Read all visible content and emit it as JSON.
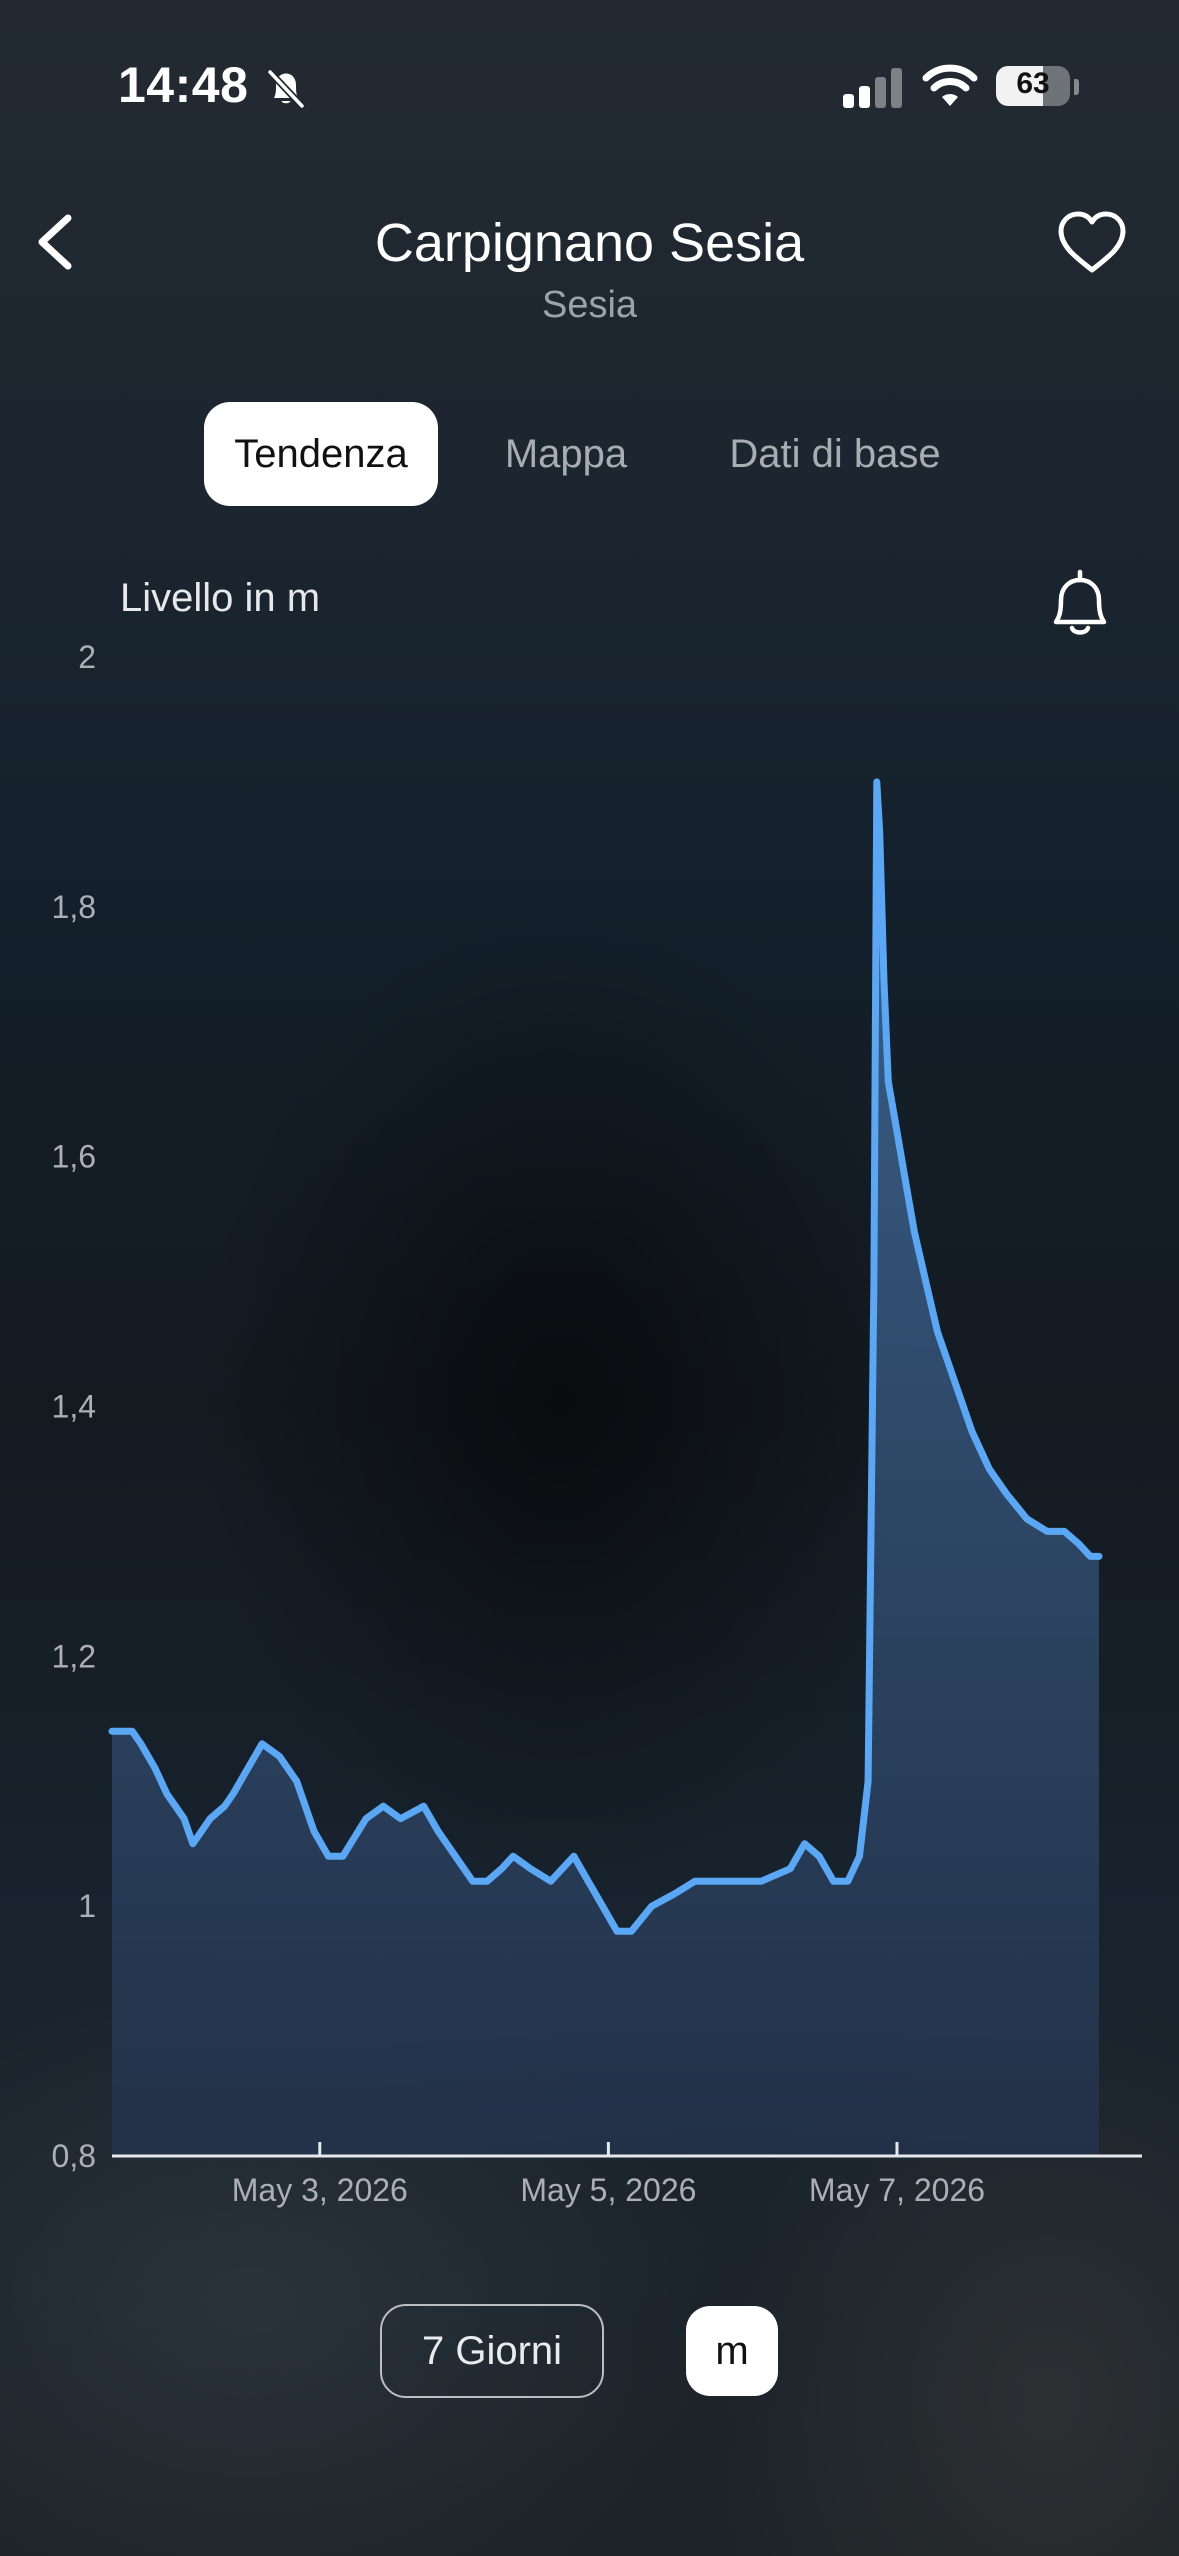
{
  "status_bar": {
    "time": "14:48",
    "battery": "63",
    "battery_level": 0.63,
    "icons": [
      "bell-slash-icon",
      "cellular-signal-icon",
      "wifi-icon",
      "battery-icon"
    ]
  },
  "header": {
    "title": "Carpignano Sesia",
    "subtitle": "Sesia",
    "back_icon": "chevron-left-icon",
    "favorite_icon": "heart-outline-icon"
  },
  "tabs": [
    {
      "label": "Tendenza",
      "active": true
    },
    {
      "label": "Mappa",
      "active": false
    },
    {
      "label": "Dati di base",
      "active": false
    }
  ],
  "chart_caption": "Livello in m",
  "alarm_icon": "bell-icon",
  "colors": {
    "line": "#5aa8f5",
    "area_top": "#3d6590",
    "area_bottom": "#23324a",
    "active_tab_bg": "#ffffff"
  },
  "chart_data": {
    "type": "area",
    "ylabel": "Livello in m",
    "ylim": [
      0.8,
      2.0
    ],
    "ytick_labels": [
      "2",
      "1,8",
      "1,6",
      "1,4",
      "1,2",
      "1",
      "0,8"
    ],
    "ytick_values": [
      2.0,
      1.8,
      1.6,
      1.4,
      1.2,
      1.0,
      0.8
    ],
    "xlim": [
      1.56,
      8.4
    ],
    "xtick_labels": [
      "May 3, 2026",
      "May 5, 2026",
      "May 7, 2026"
    ],
    "xtick_values": [
      3,
      5,
      7
    ],
    "series": [
      {
        "x": [
          1.56,
          1.7,
          1.76,
          1.86,
          1.94,
          2.0,
          2.06,
          2.12,
          2.18,
          2.24,
          2.34,
          2.4,
          2.5,
          2.6,
          2.72,
          2.84,
          2.96,
          3.06,
          3.16,
          3.32,
          3.44,
          3.56,
          3.72,
          3.82,
          3.94,
          4.06,
          4.16,
          4.26,
          4.34,
          4.46,
          4.6,
          4.76,
          4.86,
          4.96,
          5.06,
          5.16,
          5.3,
          5.46,
          5.6,
          5.8,
          6.06,
          6.26,
          6.36,
          6.46,
          6.56,
          6.66,
          6.74,
          6.8,
          6.84,
          6.86,
          6.88,
          6.91,
          6.94,
          7.0,
          7.06,
          7.12,
          7.2,
          7.28,
          7.4,
          7.52,
          7.64,
          7.76,
          7.9,
          8.04,
          8.16,
          8.26,
          8.34,
          8.4
        ],
        "values": [
          1.14,
          1.14,
          1.13,
          1.11,
          1.09,
          1.08,
          1.07,
          1.05,
          1.06,
          1.07,
          1.08,
          1.09,
          1.11,
          1.13,
          1.12,
          1.1,
          1.06,
          1.04,
          1.04,
          1.07,
          1.08,
          1.07,
          1.08,
          1.06,
          1.04,
          1.02,
          1.02,
          1.03,
          1.04,
          1.03,
          1.02,
          1.04,
          1.02,
          1.0,
          0.98,
          0.98,
          1.0,
          1.01,
          1.02,
          1.02,
          1.02,
          1.03,
          1.05,
          1.04,
          1.02,
          1.02,
          1.04,
          1.1,
          1.5,
          1.9,
          1.86,
          1.74,
          1.66,
          1.62,
          1.58,
          1.54,
          1.5,
          1.46,
          1.42,
          1.38,
          1.35,
          1.33,
          1.31,
          1.3,
          1.3,
          1.29,
          1.28,
          1.28
        ]
      }
    ]
  },
  "controls": {
    "range_label": "7 Giorni",
    "unit_label": "m"
  }
}
